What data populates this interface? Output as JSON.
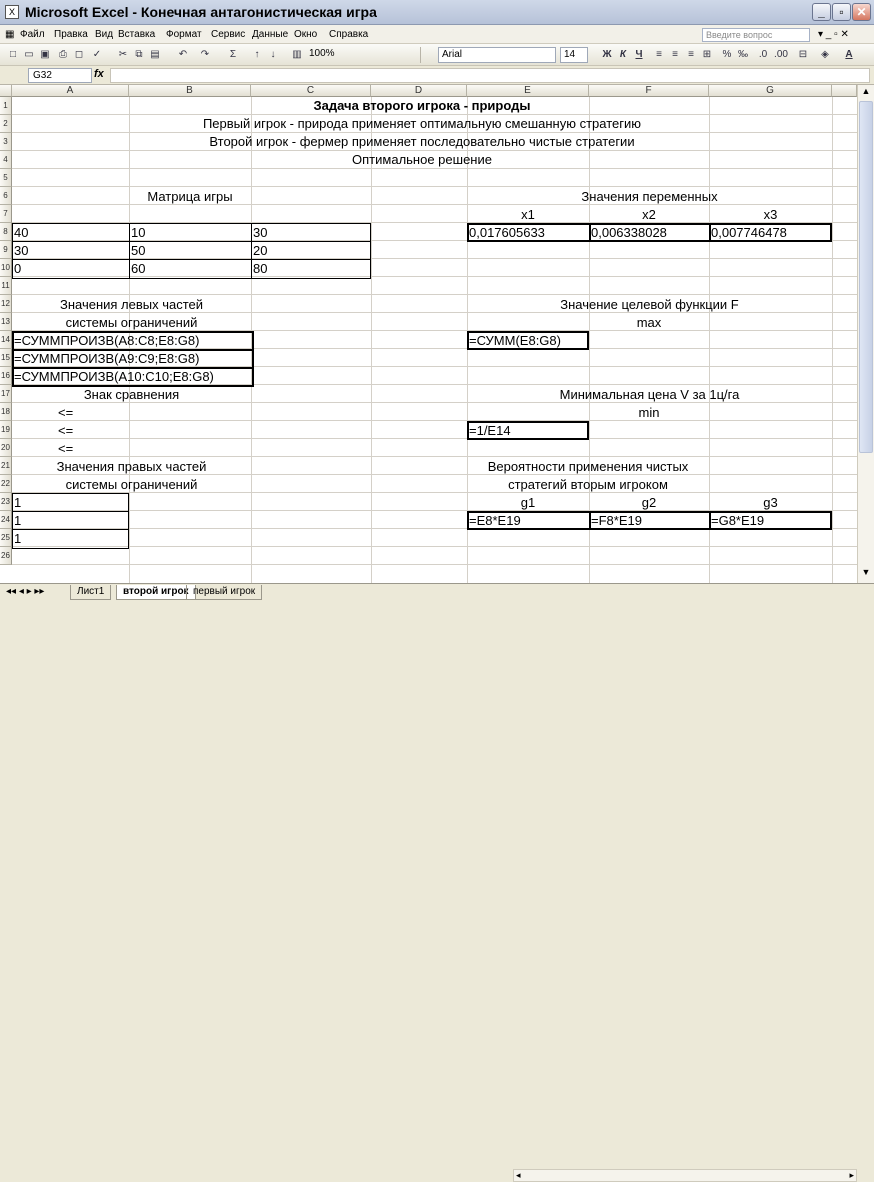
{
  "window": {
    "title": "Microsoft Excel - Конечная антагонистическая игра"
  },
  "menu": [
    "Файл",
    "Правка",
    "Вид",
    "Вставка",
    "Формат",
    "Сервис",
    "Данные",
    "Окно",
    "Справка"
  ],
  "help_placeholder": "Введите вопрос",
  "toolbar": {
    "zoom": "100%",
    "font": "Arial",
    "size": "14",
    "bold": "Ж",
    "italic": "К",
    "underline": "Ч"
  },
  "formula_bar": {
    "name_box": "G32",
    "fx": "fx",
    "value": ""
  },
  "columns": [
    "A",
    "B",
    "C",
    "D",
    "E",
    "F",
    "G"
  ],
  "rows": [
    "1",
    "2",
    "3",
    "4",
    "5",
    "6",
    "7",
    "8",
    "9",
    "10",
    "11",
    "12",
    "13",
    "14",
    "15",
    "16",
    "17",
    "18",
    "19",
    "20",
    "21",
    "22",
    "23",
    "24",
    "25",
    "26"
  ],
  "cells": {
    "r1": "Задача второго игрока - природы",
    "r2": "Первый игрок - природа  применяет оптимальную смешанную стратегию",
    "r3": "Второй игрок -  фермер  применяет последовательно чистые стратегии",
    "r4": "Оптимальное решение",
    "b6": "Матрица игры",
    "f6": "Значения переменных",
    "e7": "x1",
    "f7": "x2",
    "g7": "x3",
    "a8": "40",
    "b8": "10",
    "c8": "30",
    "e8": "0,017605633",
    "f8": "0,006338028",
    "g8": "0,007746478",
    "a9": "30",
    "b9": "50",
    "c9": "20",
    "a10": "0",
    "b10": "60",
    "c10": "80",
    "a12": "Значения левых частей",
    "f12": "Значение целевой функции F",
    "a13": "системы ограничений",
    "f13": "max",
    "a14": "=СУММПРОИЗВ(A8:C8;E8:G8)",
    "e14": "=СУММ(E8:G8)",
    "a15": "=СУММПРОИЗВ(A9:C9;E8:G8)",
    "a16": "=СУММПРОИЗВ(A10:C10;E8:G8)",
    "a17": "Знак сравнения",
    "f17": "Минимальная цена  V за 1ц/га",
    "a18": "<=",
    "f18": "min",
    "a19": "<=",
    "e19": "=1/E14",
    "a20": "<=",
    "a21": "Значения правых частей",
    "f21": "Вероятности применения чистых",
    "a22": "системы ограничений",
    "f22": "стратегий вторым игроком",
    "e23": "g1",
    "f23": "g2",
    "g23": "g3",
    "a23": "1",
    "a24": "1",
    "a25": "1",
    "e24": "=E8*E19",
    "f24": "=F8*E19",
    "g24": "=G8*E19"
  },
  "sheets": [
    "Лист1",
    "второй игрок",
    "первый игрок"
  ]
}
